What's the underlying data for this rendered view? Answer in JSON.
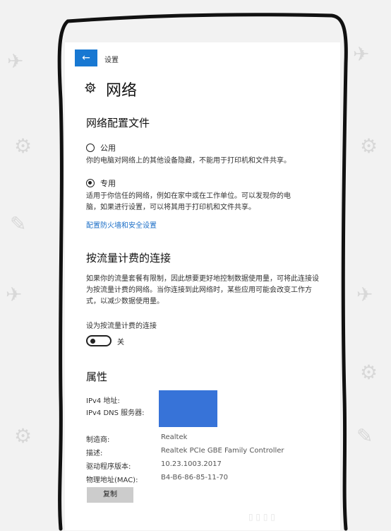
{
  "window": {
    "breadcrumb": "设置"
  },
  "header": {
    "title": "网络",
    "icon": "gear-icon"
  },
  "profile": {
    "heading": "网络配置文件",
    "options": [
      {
        "label": "公用",
        "checked": false,
        "description": "你的电脑对网络上的其他设备隐藏，不能用于打印机和文件共享。"
      },
      {
        "label": "专用",
        "checked": true,
        "description": "适用于你信任的网络，例如在家中或在工作单位。可以发现你的电脑，如果进行设置，可以将其用于打印机和文件共享。"
      }
    ],
    "firewall_link": "配置防火墙和安全设置"
  },
  "metered": {
    "heading": "按流量计费的连接",
    "description": "如果你的流量套餐有限制，因此想要更好地控制数据使用量，可将此连接设为按流量计费的网络。当你连接到此网络时，某些应用可能会改变工作方式，以减少数据使用量。",
    "toggle_label": "设为按流量计费的连接",
    "toggle_state": "关",
    "toggle_on": false
  },
  "properties": {
    "heading": "属性",
    "rows": [
      {
        "label": "IPv4 地址:",
        "value": ""
      },
      {
        "label": "IPv4 DNS 服务器:",
        "value": ""
      },
      {
        "label": "制造商:",
        "value": "Realtek"
      },
      {
        "label": "描述:",
        "value": "Realtek PCIe GBE Family Controller"
      },
      {
        "label": "驱动程序版本:",
        "value": "10.23.1003.2017"
      },
      {
        "label": "物理地址(MAC):",
        "value": "B4-B6-86-85-11-70"
      }
    ],
    "copy_button": "复制"
  },
  "colors": {
    "accent": "#1878d2",
    "link": "#1c6fc7",
    "redaction": "#3773d8"
  }
}
